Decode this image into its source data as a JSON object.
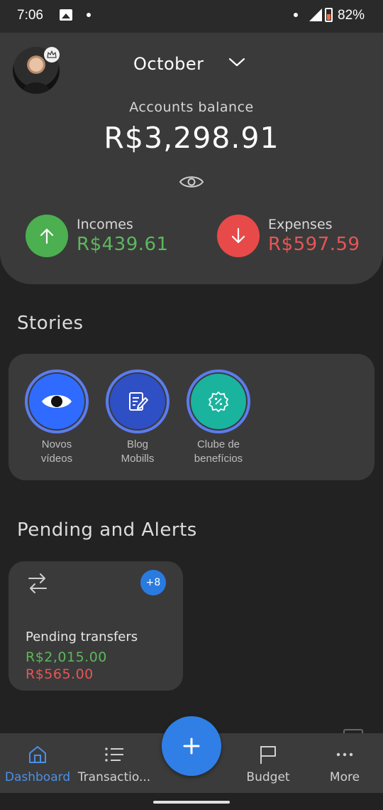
{
  "status_bar": {
    "time": "7:06",
    "battery": "82%"
  },
  "header": {
    "month": "October",
    "balance_label": "Accounts balance",
    "balance_value": "R$3,298.91",
    "incomes_label": "Incomes",
    "incomes_value": "R$439.61",
    "expenses_label": "Expenses",
    "expenses_value": "R$597.59",
    "colors": {
      "income": "#4caf50",
      "expense": "#e84a4a"
    }
  },
  "stories": {
    "title": "Stories",
    "items": [
      {
        "line1": "Novos",
        "line2": "vídeos",
        "icon": "eye-icon"
      },
      {
        "line1": "Blog",
        "line2": "Mobills",
        "icon": "document-edit-icon"
      },
      {
        "line1": "Clube de",
        "line2": "benefícios",
        "icon": "discount-badge-icon"
      }
    ]
  },
  "pending": {
    "title": "Pending and Alerts",
    "card_title": "Pending transfers",
    "badge": "+8",
    "amount_in": "R$2,015.00",
    "amount_out": "R$565.00"
  },
  "nav": {
    "items": [
      {
        "label": "Dashboard",
        "icon": "home-icon",
        "active": true
      },
      {
        "label": "Transactio...",
        "icon": "list-icon"
      },
      {
        "label": "Budget",
        "icon": "flag-icon"
      },
      {
        "label": "More",
        "icon": "more-dots-icon"
      }
    ],
    "fab_icon": "plus-icon",
    "accent": "#2f7fe6"
  }
}
